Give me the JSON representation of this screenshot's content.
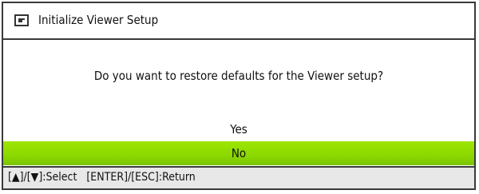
{
  "dialog": {
    "title": "Initialize Viewer Setup",
    "icon": "viewer-icon",
    "message": "Do you want to restore defaults for the Viewer setup?",
    "options": [
      {
        "label": "Yes",
        "selected": false
      },
      {
        "label": "No",
        "selected": true
      }
    ],
    "selected_color": "#8bd800"
  },
  "statusbar": {
    "select_hint": "[▲]/[▼]:Select",
    "return_hint": "[ENTER]/[ESC]:Return"
  }
}
